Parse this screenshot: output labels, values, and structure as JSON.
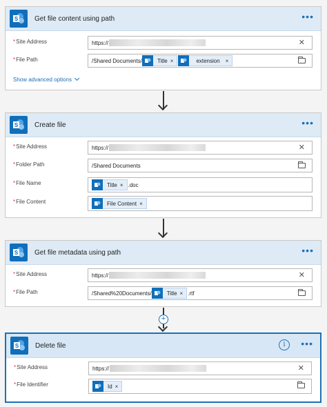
{
  "actions": [
    {
      "title": "Get file content using path",
      "fields": [
        {
          "label": "Site Address",
          "value": "https://"
        },
        {
          "label": "File Path",
          "value": "/Shared Documents/",
          "tokens": [
            {
              "label": "Title"
            },
            {
              "label": "extension"
            }
          ]
        }
      ],
      "advanced": "Show advanced options"
    },
    {
      "title": "Create file",
      "fields": [
        {
          "label": "Site Address",
          "value": "https://"
        },
        {
          "label": "Folder Path",
          "value": "/Shared Documents"
        },
        {
          "label": "File Name",
          "token": "Title",
          "suffix": ".doc"
        },
        {
          "label": "File Content",
          "token": "File Content"
        }
      ]
    },
    {
      "title": "Get file metadata using path",
      "fields": [
        {
          "label": "Site Address",
          "value": "https://"
        },
        {
          "label": "File Path",
          "value": "/Shared%20Documents/",
          "token": "Title",
          "suffix": ".rtf"
        }
      ]
    },
    {
      "title": "Delete file",
      "fields": [
        {
          "label": "Site Address",
          "value": "https://"
        },
        {
          "label": "File Identifier",
          "token": "Id"
        }
      ]
    }
  ],
  "common": {
    "required_mark": "*",
    "token_remove": "×",
    "clear_glyph": "✕",
    "more_glyph": "•••",
    "info_glyph": "i",
    "add_glyph": "+"
  },
  "icons": {
    "connector": "sharepoint-icon",
    "clear": "close-icon",
    "folder": "folder-icon",
    "more": "more-icon",
    "info": "info-icon",
    "chevron": "chevron-down-icon",
    "add": "plus-icon"
  },
  "colors": {
    "accent": "#1c6fb8",
    "header_bg": "#deebf6",
    "connector_bg": "#0f6fba",
    "required": "#d13438",
    "token_bg": "#e4eef8"
  }
}
